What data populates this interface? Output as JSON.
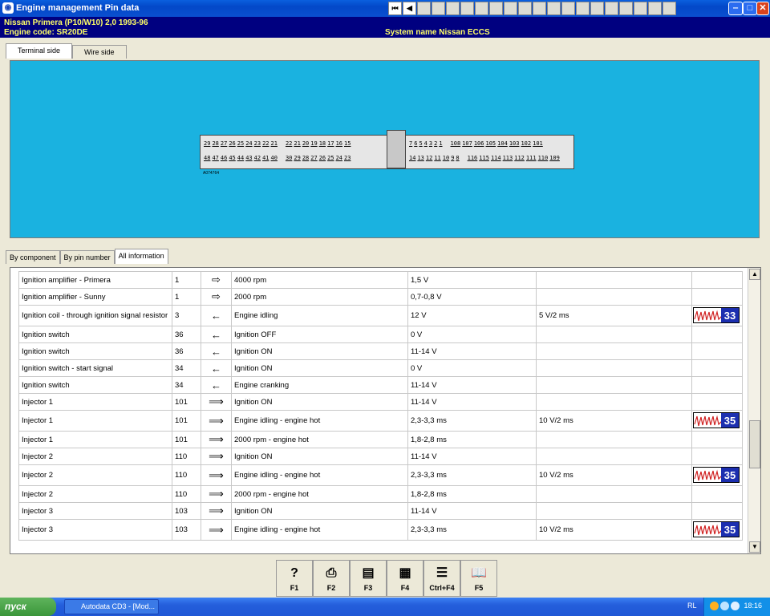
{
  "window": {
    "title": "Engine management Pin data"
  },
  "toolbar_icons": [
    "first-icon",
    "prev-icon",
    "warning-icon",
    "book-icon",
    "wrench-icon",
    "clock-icon",
    "gauge-icon",
    "page-icon",
    "belt-icon",
    "component-icon",
    "tool-icon",
    "check-icon",
    "battery-icon",
    "calendar-icon",
    "spanner-icon",
    "info-icon",
    "service-icon",
    "cdrom-icon",
    "key-icon",
    "note-icon"
  ],
  "info": {
    "vehicle": "Nissan   Primera (P10/W10) 2,0  1993-96",
    "engine": "Engine code: SR20DE",
    "system": "System name Nissan ECCS"
  },
  "view_tabs": [
    "Terminal side",
    "Wire side"
  ],
  "connector": {
    "top_left": [
      "29",
      "28",
      "27",
      "26",
      "25",
      "24",
      "23",
      "22",
      "21",
      "22",
      "21",
      "20",
      "19",
      "18",
      "17",
      "16",
      "15"
    ],
    "bottom_left": [
      "48",
      "47",
      "46",
      "45",
      "44",
      "43",
      "42",
      "41",
      "40",
      "30",
      "29",
      "28",
      "27",
      "26",
      "25",
      "24",
      "23"
    ],
    "top_right": [
      "7",
      "6",
      "5",
      "4",
      "3",
      "2",
      "1",
      "108",
      "107",
      "106",
      "105",
      "104",
      "103",
      "102",
      "101"
    ],
    "bottom_right": [
      "14",
      "13",
      "12",
      "11",
      "10",
      "9",
      "8",
      "116",
      "115",
      "114",
      "113",
      "112",
      "111",
      "110",
      "109"
    ],
    "partno": "A074764"
  },
  "list_tabs": [
    "By component",
    "By pin number",
    "All information"
  ],
  "rows": [
    {
      "component": "Ignition amplifier - Primera",
      "pin": "1",
      "dir": "⇨",
      "condition": "4000 rpm",
      "value": "1,5 V",
      "scope": "",
      "wf": ""
    },
    {
      "component": "Ignition amplifier - Sunny",
      "pin": "1",
      "dir": "⇨",
      "condition": "2000 rpm",
      "value": "0,7-0,8 V",
      "scope": "",
      "wf": ""
    },
    {
      "component": "Ignition coil - through ignition signal resistor",
      "pin": "3",
      "dir": "←",
      "condition": "Engine idling",
      "value": "12 V",
      "scope": "5 V/2 ms",
      "wf": "33"
    },
    {
      "component": "Ignition switch",
      "pin": "36",
      "dir": "←",
      "condition": "Ignition OFF",
      "value": "0 V",
      "scope": "",
      "wf": ""
    },
    {
      "component": "Ignition switch",
      "pin": "36",
      "dir": "←",
      "condition": "Ignition ON",
      "value": "11-14 V",
      "scope": "",
      "wf": ""
    },
    {
      "component": "Ignition switch - start signal",
      "pin": "34",
      "dir": "←",
      "condition": "Ignition ON",
      "value": "0 V",
      "scope": "",
      "wf": ""
    },
    {
      "component": "Ignition switch",
      "pin": "34",
      "dir": "←",
      "condition": "Engine cranking",
      "value": "11-14 V",
      "scope": "",
      "wf": ""
    },
    {
      "component": "Injector 1",
      "pin": "101",
      "dir": "⟹",
      "condition": "Ignition ON",
      "value": "11-14 V",
      "scope": "",
      "wf": ""
    },
    {
      "component": "Injector 1",
      "pin": "101",
      "dir": "⟹",
      "condition": "Engine idling - engine hot",
      "value": "2,3-3,3 ms",
      "scope": "10 V/2 ms",
      "wf": "35"
    },
    {
      "component": "Injector 1",
      "pin": "101",
      "dir": "⟹",
      "condition": "2000 rpm - engine hot",
      "value": "1,8-2,8 ms",
      "scope": "",
      "wf": ""
    },
    {
      "component": "Injector 2",
      "pin": "110",
      "dir": "⟹",
      "condition": "Ignition ON",
      "value": "11-14 V",
      "scope": "",
      "wf": ""
    },
    {
      "component": "Injector 2",
      "pin": "110",
      "dir": "⟹",
      "condition": "Engine idling - engine hot",
      "value": "2,3-3,3 ms",
      "scope": "10 V/2 ms",
      "wf": "35"
    },
    {
      "component": "Injector 2",
      "pin": "110",
      "dir": "⟹",
      "condition": "2000 rpm - engine hot",
      "value": "1,8-2,8 ms",
      "scope": "",
      "wf": ""
    },
    {
      "component": "Injector 3",
      "pin": "103",
      "dir": "⟹",
      "condition": "Ignition ON",
      "value": "11-14 V",
      "scope": "",
      "wf": ""
    },
    {
      "component": "Injector 3",
      "pin": "103",
      "dir": "⟹",
      "condition": "Engine idling - engine hot",
      "value": "2,3-3,3 ms",
      "scope": "10 V/2 ms",
      "wf": "35"
    }
  ],
  "fkeys": [
    {
      "label": "F1",
      "icon": "help-icon",
      "glyph": "?"
    },
    {
      "label": "F2",
      "icon": "print-icon",
      "glyph": "⎙"
    },
    {
      "label": "F3",
      "icon": "copy-icon",
      "glyph": "▤"
    },
    {
      "label": "F4",
      "icon": "print-preview-icon",
      "glyph": "▦"
    },
    {
      "label": "Ctrl+F4",
      "icon": "list-icon",
      "glyph": "☰"
    },
    {
      "label": "F5",
      "icon": "book-icon",
      "glyph": "📖"
    }
  ],
  "taskbar": {
    "start": "пуск",
    "item": "Autodata CD3 - [Mod...",
    "lang": "RL",
    "clock": "18:16"
  },
  "colors": {
    "titlebar": "#0348c8",
    "infobar": "#000080",
    "infotext": "#ffff66",
    "diagram": "#1ab2e0",
    "waveform": "#1c2fb0"
  }
}
